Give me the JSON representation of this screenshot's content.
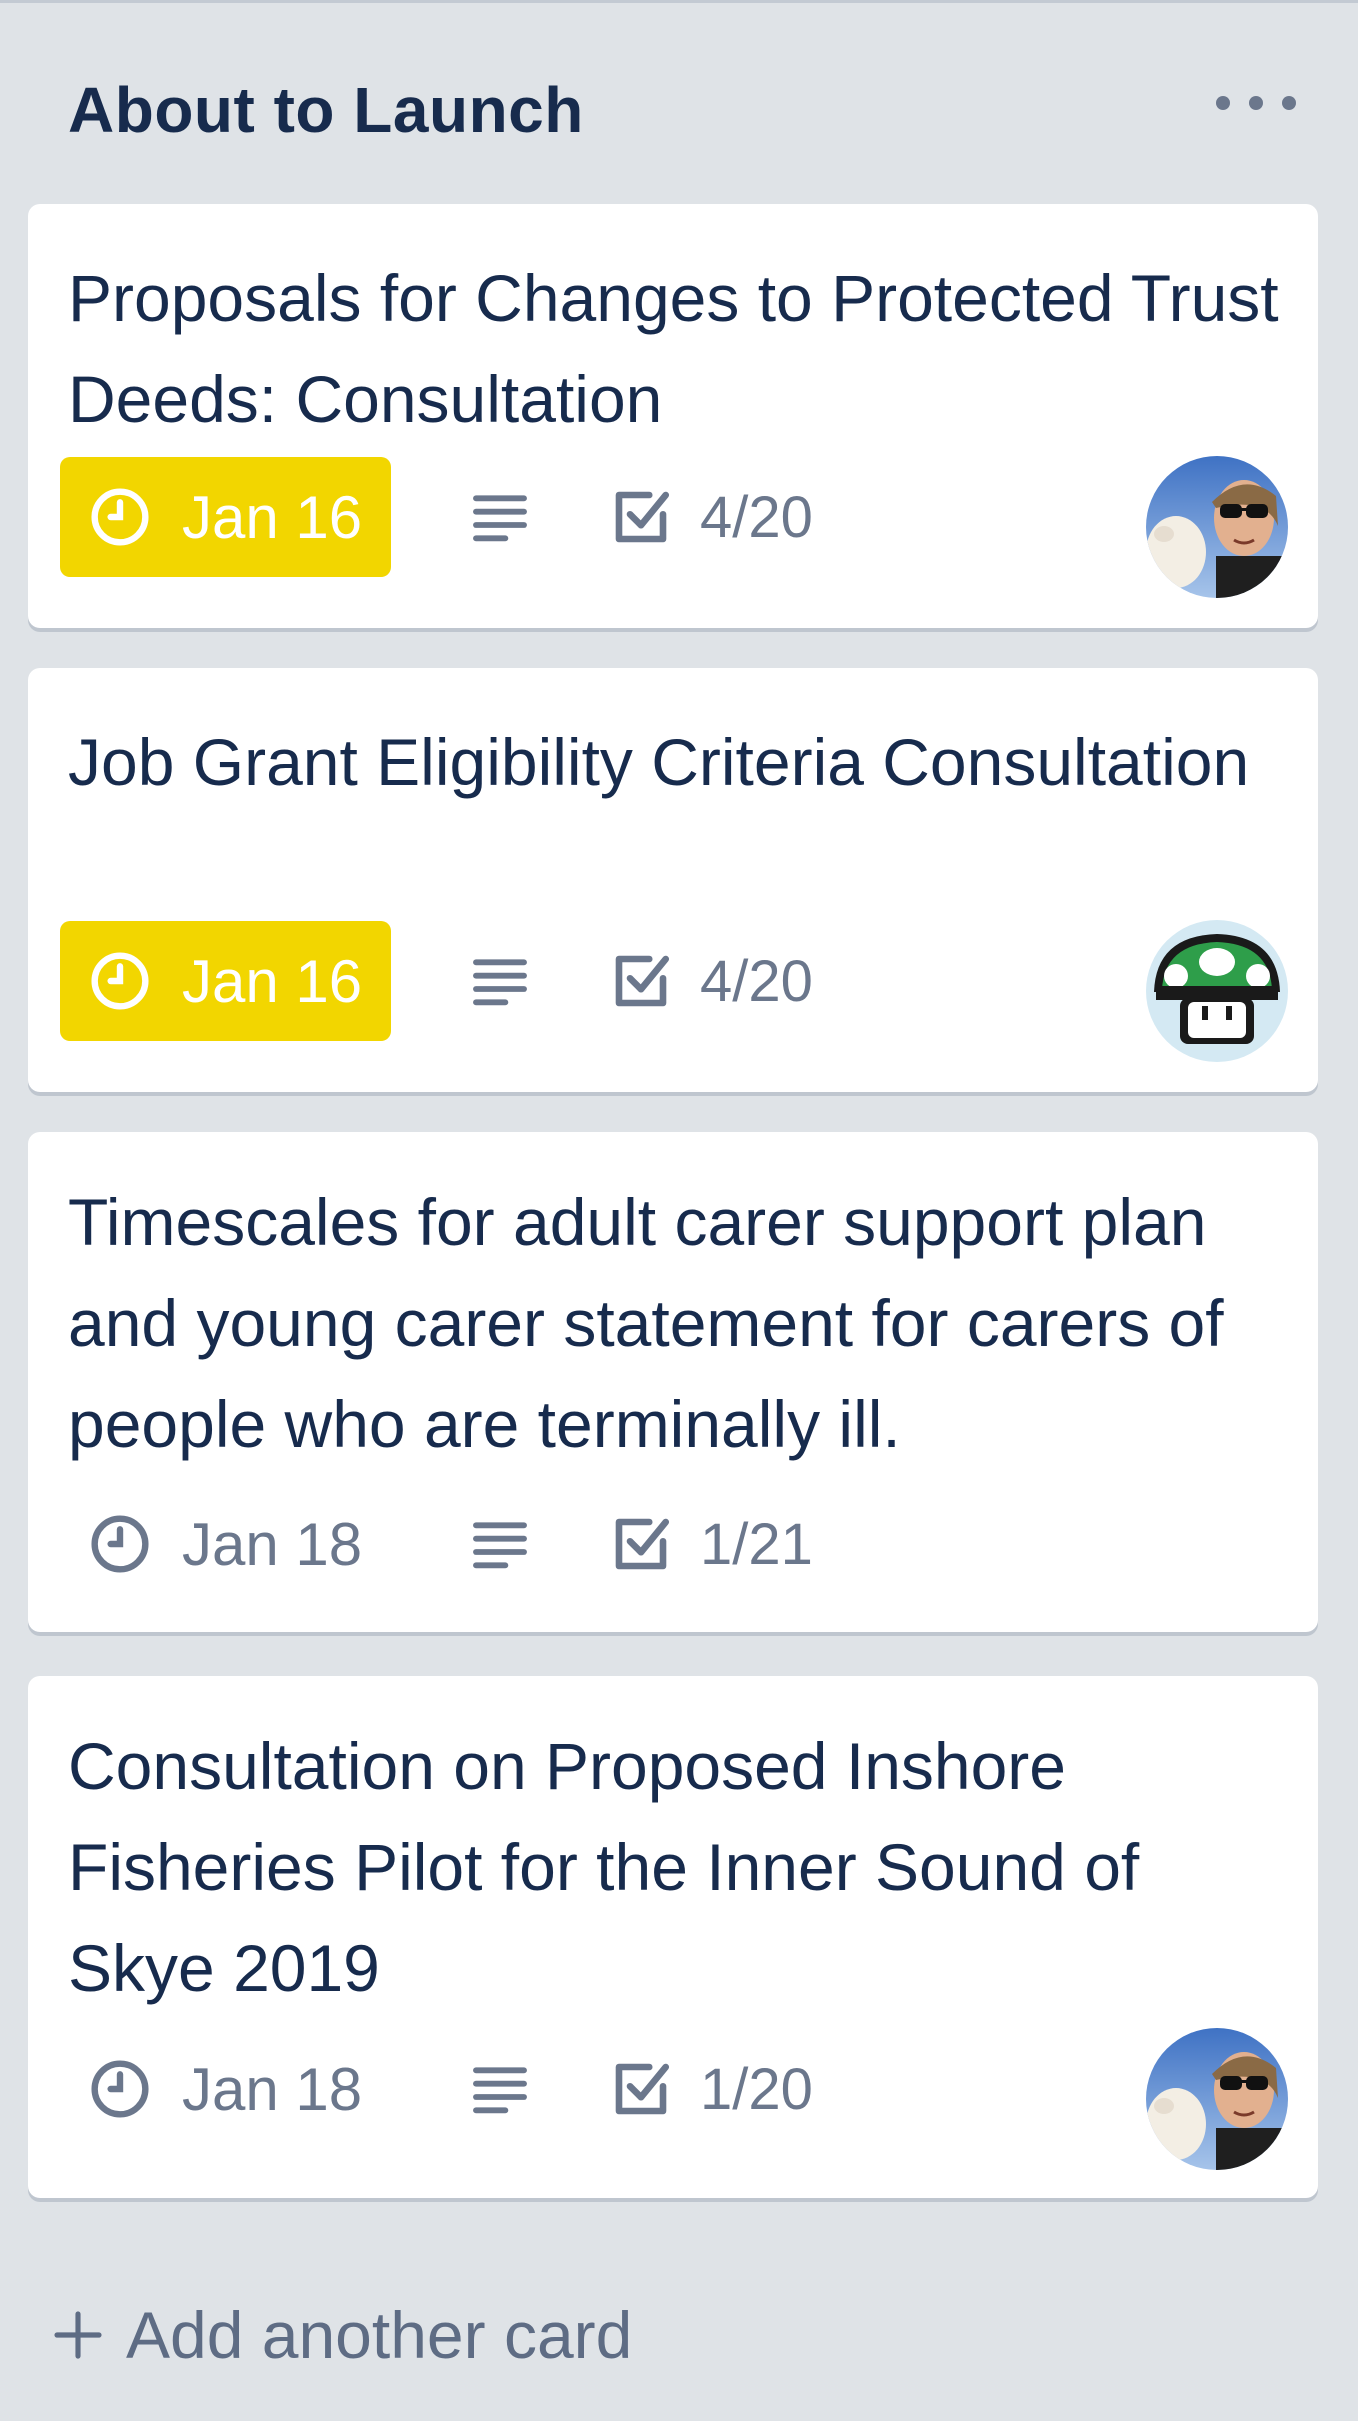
{
  "list": {
    "title": "About to Launch",
    "menu_icon": "ellipsis-icon",
    "add_card_label": "Add another card",
    "add_card_icon": "plus-icon"
  },
  "cards": [
    {
      "title": "Proposals for Changes to Protected Trust Deeds: Consultation",
      "due": "Jan 16",
      "due_highlighted": true,
      "due_color": "#f2d600",
      "has_description": true,
      "checklist": "4/20",
      "avatar": "photo-avatar"
    },
    {
      "title": "Job Grant Eligibility Criteria Consultation",
      "due": "Jan 16",
      "due_highlighted": true,
      "due_color": "#f2d600",
      "has_description": true,
      "checklist": "4/20",
      "avatar": "mushroom-avatar"
    },
    {
      "title": "Timescales for adult carer support plan and young carer statement for carers of people who are terminally ill.",
      "due": "Jan 18",
      "due_highlighted": false,
      "has_description": true,
      "checklist": "1/21",
      "avatar": null
    },
    {
      "title": "Consultation on Proposed Inshore Fisheries Pilot for the Inner Sound of Skye 2019",
      "due": "Jan 18",
      "due_highlighted": false,
      "has_description": true,
      "checklist": "1/20",
      "avatar": "photo-avatar"
    }
  ],
  "colors": {
    "list_background": "#dfe3e7",
    "card_background": "#ffffff",
    "title_text": "#172b4d",
    "muted_text": "#6b778c",
    "due_badge_yellow": "#f2d600"
  }
}
